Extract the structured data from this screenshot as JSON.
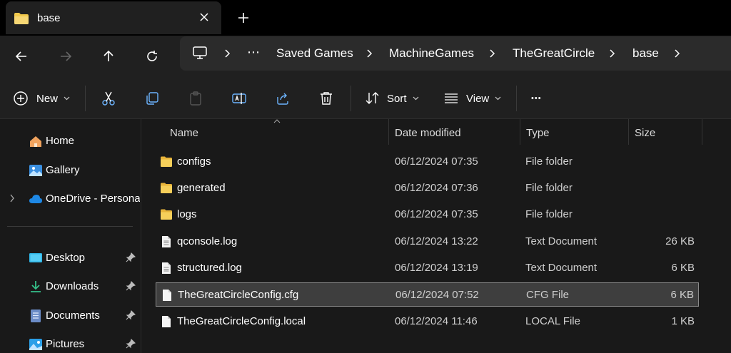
{
  "tab": {
    "title": "base",
    "icon": "folder-icon"
  },
  "breadcrumb": {
    "overflow": "⋯",
    "items": [
      "Saved Games",
      "MachineGames",
      "TheGreatCircle",
      "base"
    ]
  },
  "commands": {
    "new_label": "New",
    "sort_label": "Sort",
    "view_label": "View",
    "more_label": "•••"
  },
  "sidebar": {
    "items": [
      {
        "label": "Home",
        "icon": "home-icon"
      },
      {
        "label": "Gallery",
        "icon": "gallery-icon"
      },
      {
        "label": "OneDrive - Personal",
        "icon": "cloud-icon"
      },
      {
        "label": "Desktop",
        "icon": "desktop-icon",
        "pinned": true
      },
      {
        "label": "Downloads",
        "icon": "download-icon",
        "pinned": true
      },
      {
        "label": "Documents",
        "icon": "document-icon",
        "pinned": true
      },
      {
        "label": "Pictures",
        "icon": "pictures-icon",
        "pinned": true
      }
    ]
  },
  "columns": {
    "name": "Name",
    "date": "Date modified",
    "type": "Type",
    "size": "Size"
  },
  "files": [
    {
      "name": "configs",
      "date": "06/12/2024 07:35",
      "type": "File folder",
      "size": "",
      "kind": "folder"
    },
    {
      "name": "generated",
      "date": "06/12/2024 07:36",
      "type": "File folder",
      "size": "",
      "kind": "folder"
    },
    {
      "name": "logs",
      "date": "06/12/2024 07:35",
      "type": "File folder",
      "size": "",
      "kind": "folder"
    },
    {
      "name": "qconsole.log",
      "date": "06/12/2024 13:22",
      "type": "Text Document",
      "size": "26 KB",
      "kind": "text"
    },
    {
      "name": "structured.log",
      "date": "06/12/2024 13:19",
      "type": "Text Document",
      "size": "6 KB",
      "kind": "text"
    },
    {
      "name": "TheGreatCircleConfig.cfg",
      "date": "06/12/2024 07:52",
      "type": "CFG File",
      "size": "6 KB",
      "kind": "file",
      "selected": true
    },
    {
      "name": "TheGreatCircleConfig.local",
      "date": "06/12/2024 11:46",
      "type": "LOCAL File",
      "size": "1 KB",
      "kind": "file"
    }
  ],
  "colors": {
    "folder": "#f2c94c",
    "accent": "#4cc2ff",
    "selection": "#3e3e3e"
  }
}
